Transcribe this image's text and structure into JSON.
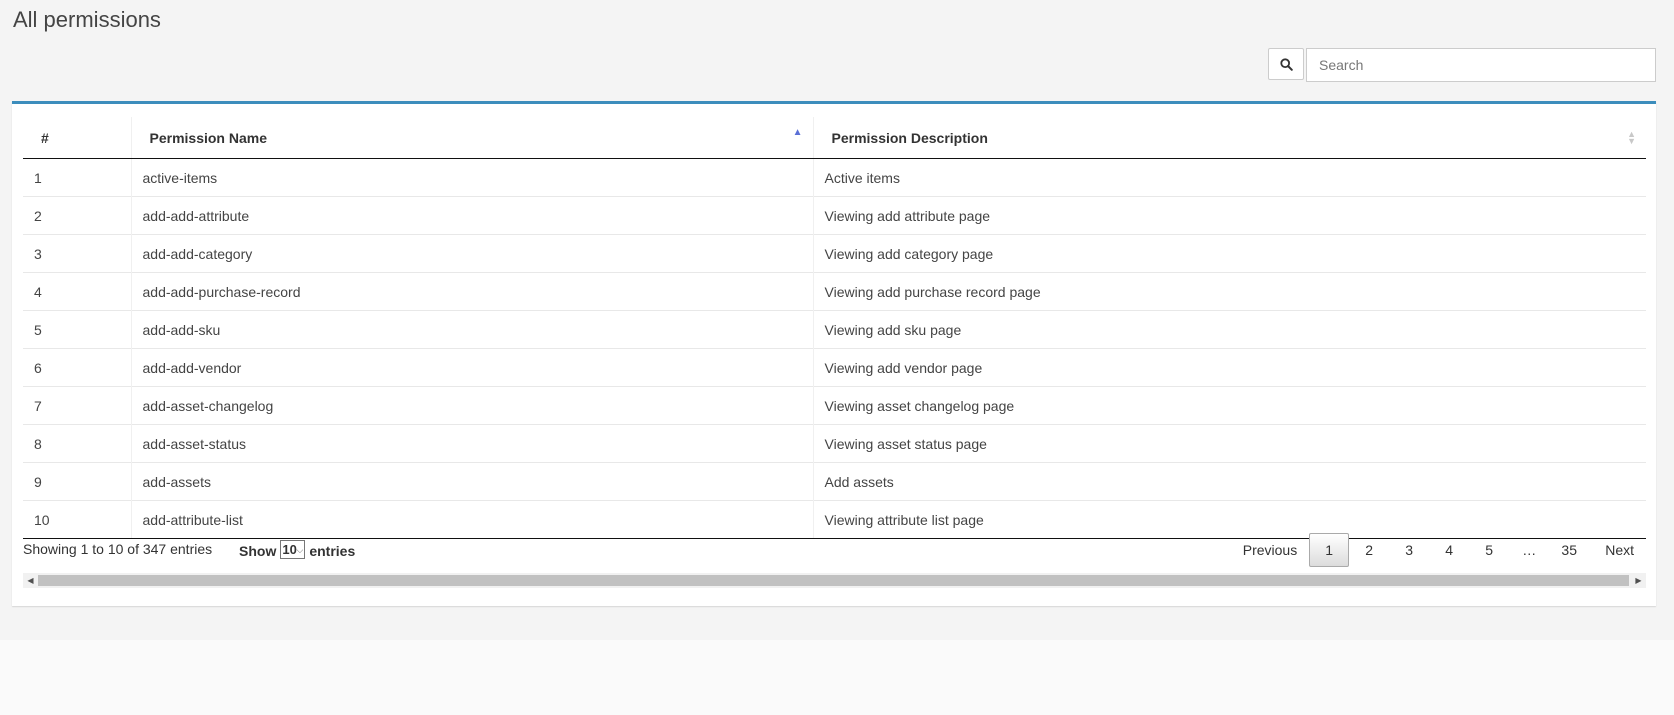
{
  "page": {
    "title": "All permissions"
  },
  "search": {
    "icon": "search-icon",
    "placeholder": "Search"
  },
  "table": {
    "columns": [
      "#",
      "Permission Name",
      "Permission Description"
    ],
    "sorted_column": "Permission Name",
    "sort_direction": "ascending",
    "rows": [
      {
        "num": "1",
        "name": "active-items",
        "description": "Active items"
      },
      {
        "num": "2",
        "name": "add-add-attribute",
        "description": "Viewing add attribute page"
      },
      {
        "num": "3",
        "name": "add-add-category",
        "description": "Viewing add category page"
      },
      {
        "num": "4",
        "name": "add-add-purchase-record",
        "description": "Viewing add purchase record page"
      },
      {
        "num": "5",
        "name": "add-add-sku",
        "description": "Viewing add sku page"
      },
      {
        "num": "6",
        "name": "add-add-vendor",
        "description": "Viewing add vendor page"
      },
      {
        "num": "7",
        "name": "add-asset-changelog",
        "description": "Viewing asset changelog page"
      },
      {
        "num": "8",
        "name": "add-asset-status",
        "description": "Viewing asset status page"
      },
      {
        "num": "9",
        "name": "add-assets",
        "description": "Add assets"
      },
      {
        "num": "10",
        "name": "add-attribute-list",
        "description": "Viewing attribute list page"
      }
    ]
  },
  "footer": {
    "info": "Showing 1 to 10 of 347 entries",
    "show_label": "Show",
    "length_value": "10",
    "entries_label": "entries"
  },
  "pagination": {
    "previous": "Previous",
    "pages": [
      "1",
      "2",
      "3",
      "4",
      "5",
      "…",
      "35"
    ],
    "current": "1",
    "next": "Next"
  },
  "colors": {
    "accent": "#3c8dbc",
    "sort_active": "#5a6fd6"
  }
}
